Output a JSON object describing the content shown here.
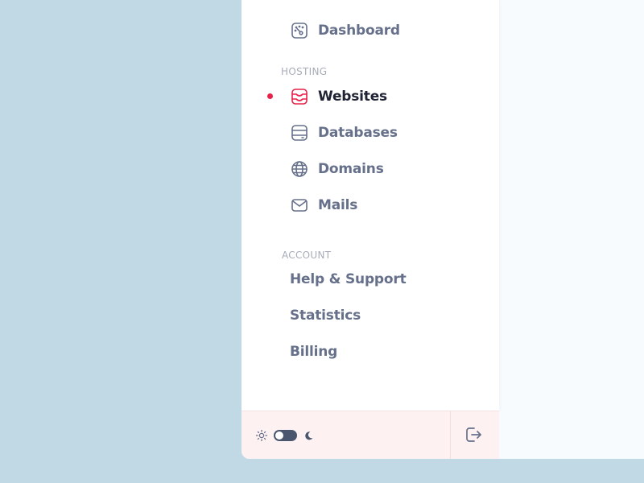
{
  "sidebar": {
    "dashboard": {
      "label": "Dashboard",
      "icon": "speedometer-icon"
    },
    "hosting_section": "HOSTING",
    "hosting_items": [
      {
        "label": "Websites",
        "icon": "inbox-icon",
        "active": true
      },
      {
        "label": "Databases",
        "icon": "database-icon",
        "active": false
      },
      {
        "label": "Domains",
        "icon": "globe-icon",
        "active": false
      },
      {
        "label": "Mails",
        "icon": "mail-icon",
        "active": false
      }
    ],
    "account_section": "ACCOUNT",
    "account_items": [
      {
        "label": "Help & Support"
      },
      {
        "label": "Statistics"
      },
      {
        "label": "Billing"
      }
    ]
  },
  "bottom_bar": {
    "theme_toggle": {
      "state": "light",
      "left_icon": "sun-icon",
      "right_icon": "moon-icon"
    },
    "logout_icon": "logout-icon"
  },
  "colors": {
    "accent": "#e8214a",
    "text_muted": "#66708a",
    "text_active": "#1f2333",
    "background": "#c1d9e5",
    "bottom_bar": "#fdf2f1"
  }
}
